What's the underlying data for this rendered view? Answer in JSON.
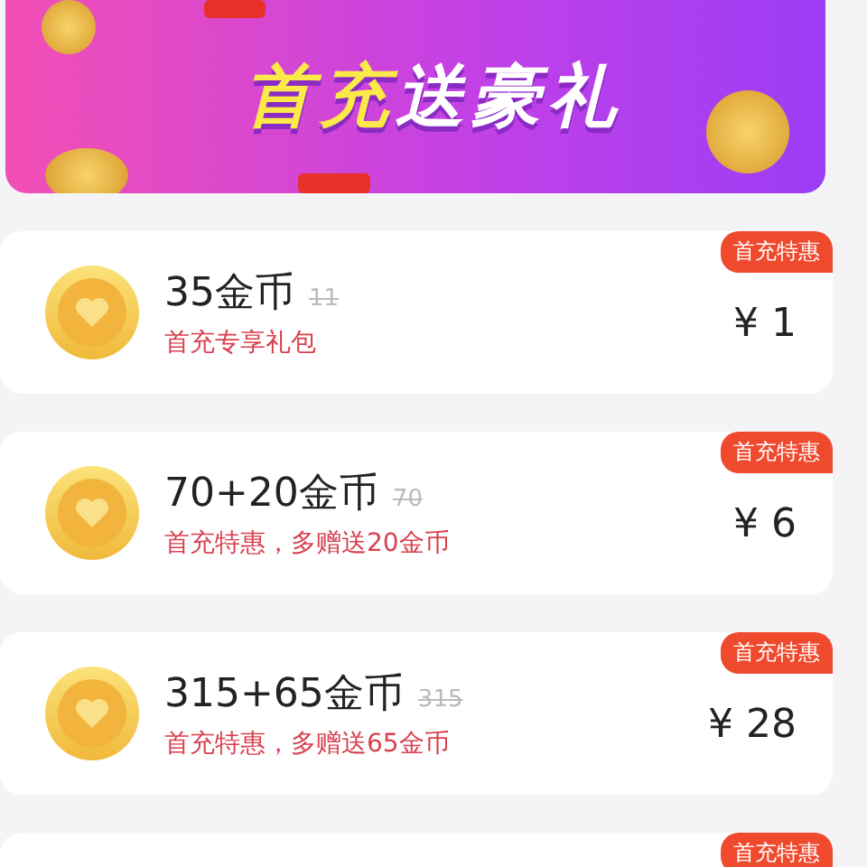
{
  "banner": {
    "title": {
      "highlight": "首充",
      "rest": "送豪礼"
    }
  },
  "packages": [
    {
      "title": "35金币",
      "original": "11",
      "subtitle": "首充专享礼包",
      "price": "¥ 1",
      "badge": "首充特惠"
    },
    {
      "title": "70+20金币",
      "original": "70",
      "subtitle": "首充特惠，多赠送20金币",
      "price": "¥ 6",
      "badge": "首充特惠"
    },
    {
      "title": "315+65金币",
      "original": "315",
      "subtitle": "首充特惠，多赠送65金币",
      "price": "¥ 28",
      "badge": "首充特惠"
    },
    {
      "badge": "首充特惠"
    }
  ]
}
